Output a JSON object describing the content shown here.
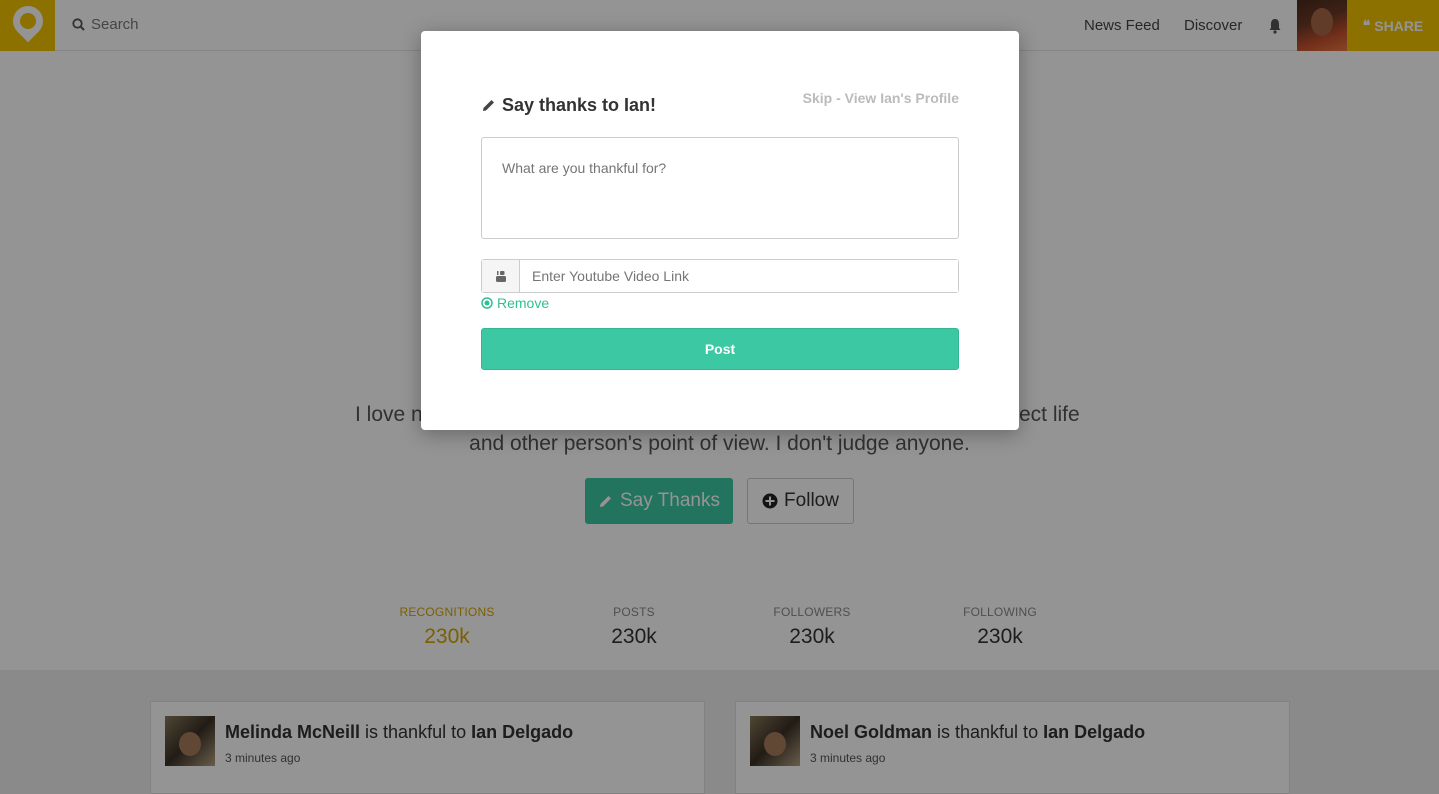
{
  "header": {
    "search_label": "Search",
    "nav": [
      "News Feed",
      "Discover"
    ],
    "share_label": "SHARE",
    "brand_color": "#f2c200"
  },
  "profile": {
    "bio_line1_left": "I love n",
    "bio_line1_right": "ect life",
    "bio_line2": "and other person's point of view. I don't judge anyone.",
    "say_thanks_label": "Say Thanks",
    "follow_label": "Follow",
    "accent_color": "#3cc8a2"
  },
  "stats": [
    {
      "label": "RECOGNITIONS",
      "value": "230k"
    },
    {
      "label": "POSTS",
      "value": "230k"
    },
    {
      "label": "FOLLOWERS",
      "value": "230k"
    },
    {
      "label": "FOLLOWING",
      "value": "230k"
    }
  ],
  "feed": [
    {
      "from": "Melinda McNeill",
      "verb": " is thankful to ",
      "to": "Ian Delgado",
      "time": "3 minutes ago"
    },
    {
      "from": "Noel Goldman",
      "verb": " is thankful to ",
      "to": "Ian Delgado",
      "time": "3 minutes ago"
    }
  ],
  "modal": {
    "title": "Say thanks to Ian!",
    "skip": "Skip - View Ian's Profile",
    "textarea_placeholder": "What are you thankful for?",
    "youtube_placeholder": "Enter Youtube Video Link",
    "remove_label": "Remove",
    "post_label": "Post"
  }
}
